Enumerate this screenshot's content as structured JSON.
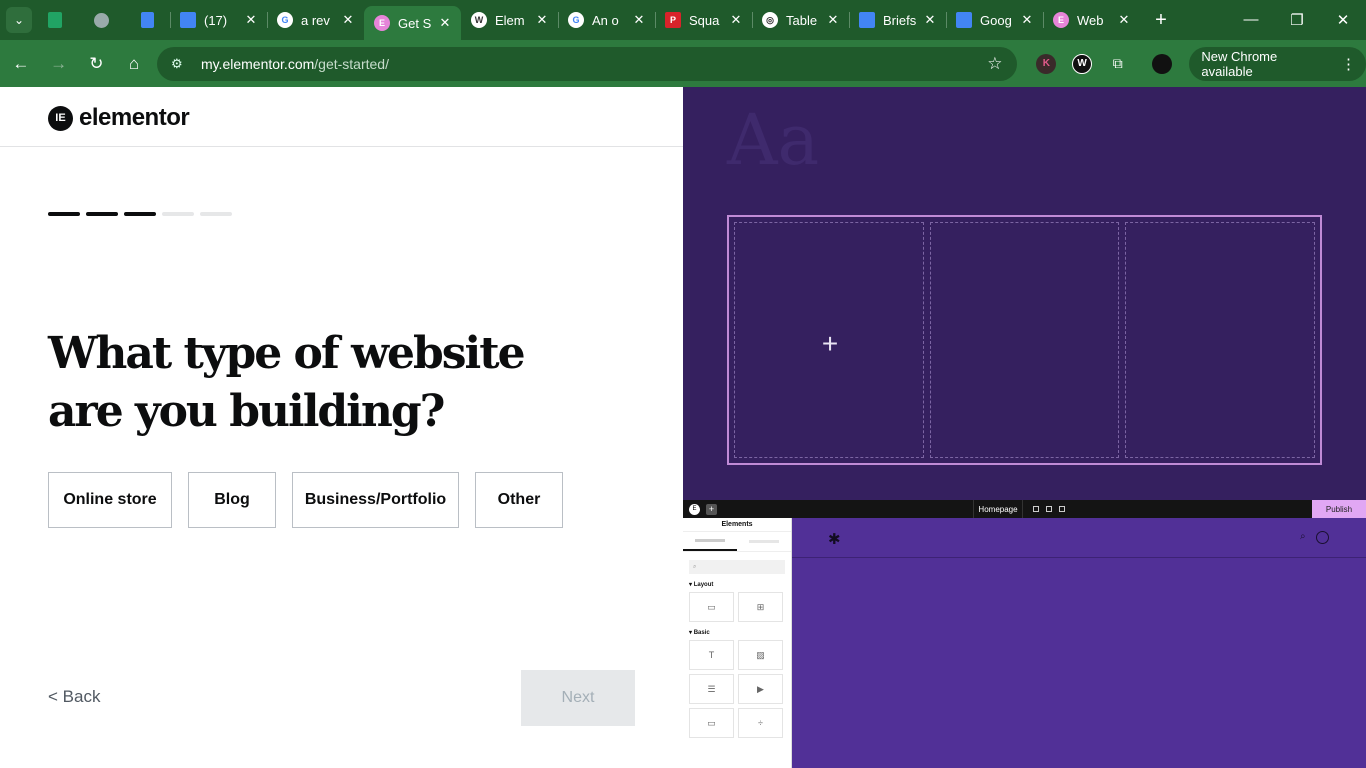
{
  "browser": {
    "tabs": [
      {
        "title": "(17)",
        "favicon": "google-docs-icon",
        "color": "#4285f4"
      },
      {
        "title": "a rev",
        "favicon": "google-g-icon",
        "color": "#ffffff"
      },
      {
        "title": "Get S",
        "favicon": "elementor-icon",
        "color": "#e685d8",
        "active": true
      },
      {
        "title": "Elem",
        "favicon": "wordpress-icon",
        "color": "#ffffff"
      },
      {
        "title": "An o",
        "favicon": "google-g-icon",
        "color": "#ffffff"
      },
      {
        "title": "Squa",
        "favicon": "pc-icon",
        "color": "#d8232a"
      },
      {
        "title": "Table",
        "favicon": "openai-icon",
        "color": "#ffffff"
      },
      {
        "title": "Briefs",
        "favicon": "google-docs-icon",
        "color": "#4285f4"
      },
      {
        "title": "Goog",
        "favicon": "google-docs-icon",
        "color": "#4285f4"
      },
      {
        "title": "Web",
        "favicon": "elementor-icon",
        "color": "#e685d8"
      }
    ],
    "url_host": "my.elementor.com",
    "url_path": "/get-started/",
    "update_label": "New Chrome available"
  },
  "onboarding": {
    "brand": "elementor",
    "progress": {
      "total": 5,
      "completed": 3
    },
    "question": "What type of website are you building?",
    "options": [
      "Online store",
      "Blog",
      "Business/Portfolio",
      "Other"
    ],
    "back_label": "< Back",
    "next_label": "Next"
  },
  "preview": {
    "typography_sample": "Aa",
    "editor": {
      "page_name": "Homepage",
      "publish_label": "Publish",
      "panel_title": "Elements",
      "section_layout": "Layout",
      "section_basic": "Basic"
    }
  },
  "colors": {
    "chrome_green": "#2d7a3e",
    "preview_bg": "#35205f",
    "canvas_purple": "#513097",
    "publish_pink": "#e1a7f4"
  }
}
